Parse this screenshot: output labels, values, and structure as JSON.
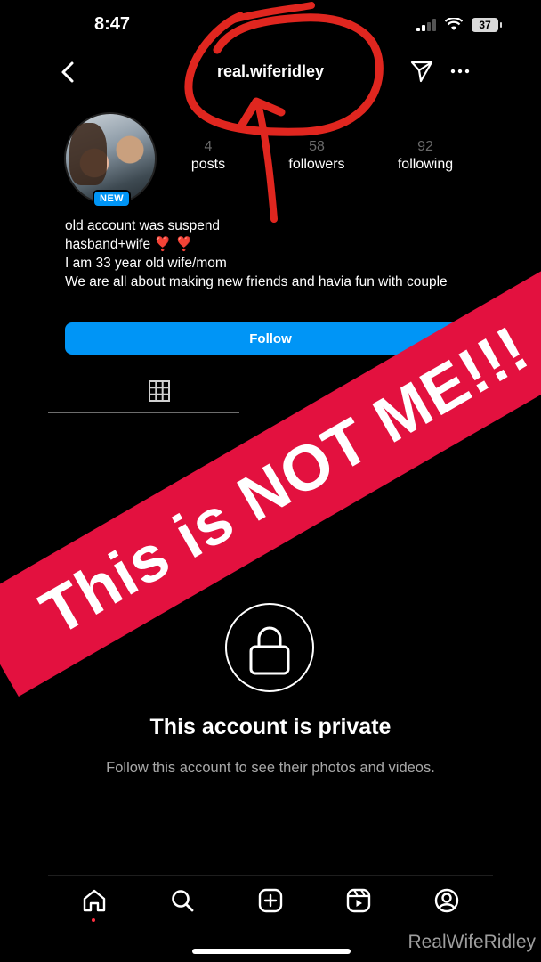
{
  "status_bar": {
    "time": "8:47",
    "battery": "37"
  },
  "header": {
    "username": "real.wiferidley"
  },
  "profile": {
    "avatar_badge": "NEW",
    "stats": [
      {
        "value": "4",
        "label": "posts"
      },
      {
        "value": "58",
        "label": "followers"
      },
      {
        "value": "92",
        "label": "following"
      }
    ],
    "bio": {
      "line1": "old account was suspend",
      "line2": "hasband+wife",
      "line2_emoji": "❣️ ❣️",
      "line3": "I am 33 year old wife/mom",
      "line4": "We are all about making new friends and havia fun with couple"
    },
    "follow_label": "Follow"
  },
  "private": {
    "title": "This account is private",
    "subtitle": "Follow this account to see their photos and videos."
  },
  "overlay": {
    "banner_text": "This is NOT ME!!!",
    "watermark": "RealWifeRidley"
  },
  "colors": {
    "accent": "#0095f6",
    "banner": "#e3113f",
    "scribble": "#e0261f",
    "notification_dot": "#ff3040"
  },
  "icons": [
    "back-arrow-icon",
    "send-icon",
    "more-icon",
    "grid-icon",
    "lock-icon",
    "home-icon",
    "search-icon",
    "create-icon",
    "reels-icon",
    "profile-icon"
  ]
}
